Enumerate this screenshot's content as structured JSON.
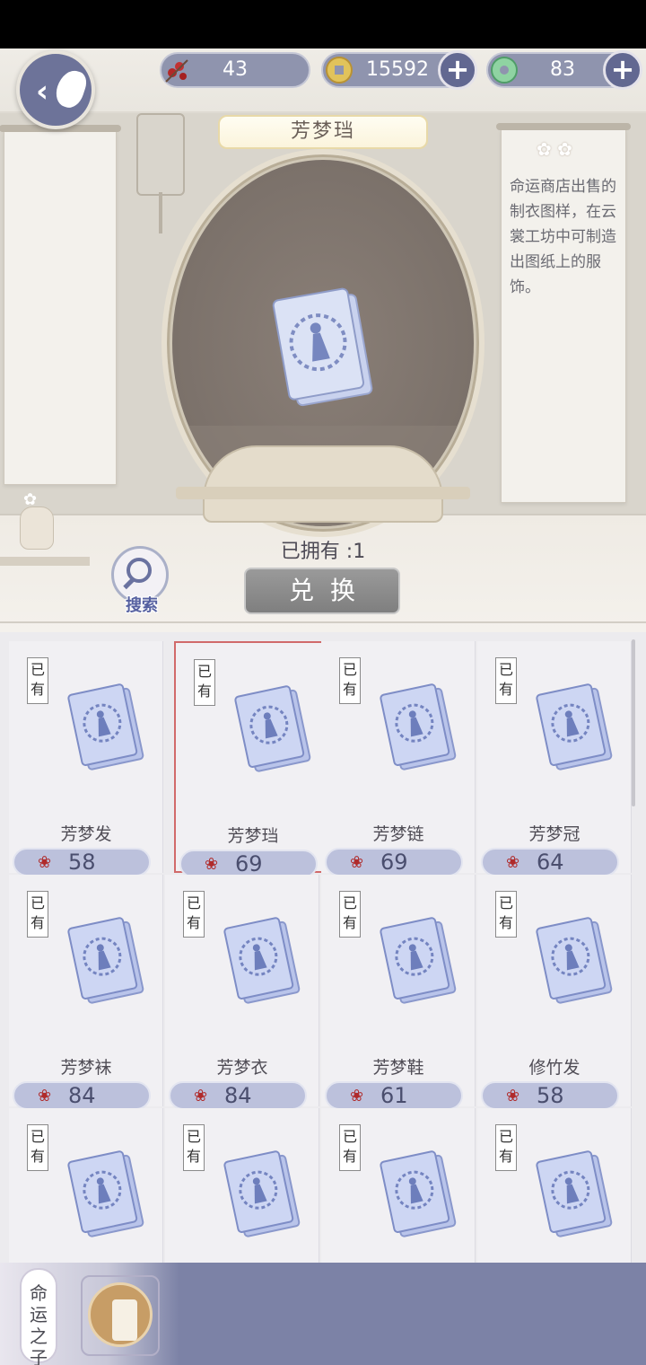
{
  "resources": {
    "fruit": {
      "value": "43",
      "icon": "red-berry-icon"
    },
    "coins": {
      "value": "15592",
      "icon": "copper-coin-icon"
    },
    "jade": {
      "value": "83",
      "icon": "jade-icon"
    }
  },
  "preview": {
    "item_name": "芳梦珰",
    "description": "命运商店出售的制衣图样，在云裳工坊中可制造出图纸上的服饰。",
    "owned_label": "已拥有 :1",
    "exchange_label": "兑换",
    "search_label": "搜索"
  },
  "items": [
    {
      "owned": "已有",
      "name": "芳梦发",
      "price": "58",
      "selected": false
    },
    {
      "owned": "已有",
      "name": "芳梦珰",
      "price": "69",
      "selected": true
    },
    {
      "owned": "已有",
      "name": "芳梦链",
      "price": "69",
      "selected": false
    },
    {
      "owned": "已有",
      "name": "芳梦冠",
      "price": "64",
      "selected": false
    },
    {
      "owned": "已有",
      "name": "芳梦袜",
      "price": "84",
      "selected": false
    },
    {
      "owned": "已有",
      "name": "芳梦衣",
      "price": "84",
      "selected": false
    },
    {
      "owned": "已有",
      "name": "芳梦鞋",
      "price": "61",
      "selected": false
    },
    {
      "owned": "已有",
      "name": "修竹发",
      "price": "58",
      "selected": false
    },
    {
      "owned": "已有",
      "name": "",
      "price": "",
      "selected": false
    },
    {
      "owned": "已有",
      "name": "",
      "price": "",
      "selected": false
    },
    {
      "owned": "已有",
      "name": "",
      "price": "",
      "selected": false
    },
    {
      "owned": "已有",
      "name": "",
      "price": "",
      "selected": false
    }
  ],
  "bottom_tabs": {
    "fate_child": "命运之子",
    "spool_icon": "thread-spool-icon"
  },
  "colors": {
    "accent": "#7c82a6",
    "selection_border": "#d16a6a",
    "price_pill": "#bcc1dc"
  }
}
